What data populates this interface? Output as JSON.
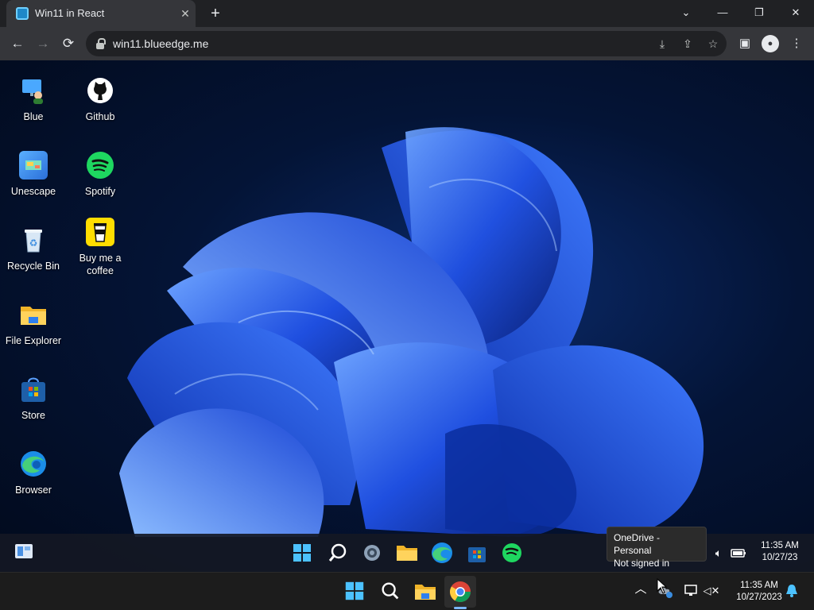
{
  "browser": {
    "tab_title": "Win11 in React",
    "tab_close": "✕",
    "new_tab": "+",
    "url": "win11.blueedge.me",
    "window_controls": {
      "minimize": "—",
      "restore": "❐",
      "close": "✕",
      "tab_search": "⌄"
    },
    "nav": {
      "back": "←",
      "forward": "→",
      "reload": "⟳"
    },
    "omnibox_icons": {
      "install": "⤓",
      "share": "⇪",
      "bookmark": "☆"
    },
    "toolbar_icons": {
      "side_panel": "▣",
      "profile": "●",
      "menu": "⋮"
    }
  },
  "desktop_icons": [
    {
      "label": "Blue",
      "icon": "user-computer-icon"
    },
    {
      "label": "Github",
      "icon": "github-icon"
    },
    {
      "label": "Unescape",
      "icon": "unescape-icon"
    },
    {
      "label": "Spotify",
      "icon": "spotify-icon"
    },
    {
      "label": "Recycle Bin",
      "icon": "recycle-bin-icon"
    },
    {
      "label": "Buy me a coffee",
      "icon": "coffee-icon"
    },
    {
      "label": "File Explorer",
      "icon": "folder-icon"
    },
    {
      "label": "Store",
      "icon": "store-icon"
    },
    {
      "label": "Browser",
      "icon": "edge-icon"
    }
  ],
  "inner_taskbar": {
    "time": "11:35 AM",
    "date": "10/27/23",
    "apps": [
      "start-icon",
      "search-icon",
      "settings-icon",
      "folder-icon",
      "edge-icon",
      "store-icon",
      "spotify-icon"
    ]
  },
  "tooltip": {
    "line1": "OneDrive - Personal",
    "line2": "Not signed in"
  },
  "host_taskbar": {
    "time": "11:35 AM",
    "date": "10/27/2023",
    "apps": [
      "start-icon",
      "search-icon",
      "folder-icon",
      "chrome-icon"
    ]
  },
  "colors": {
    "accent": "#4cc2ff",
    "chrome_dark": "#202124",
    "chrome_toolbar": "#35363a",
    "spotify": "#1ed760"
  }
}
